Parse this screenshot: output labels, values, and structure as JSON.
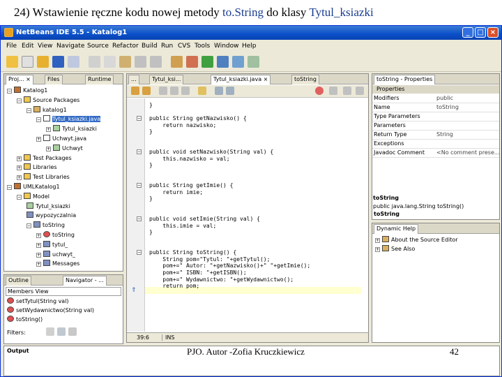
{
  "slide": {
    "title_prefix": "24) Wstawienie ręczne kodu nowej metody",
    "title_method": "to.String",
    "title_mid": "do klasy",
    "title_class": "Tytul_ksiazki",
    "footer_author": "PJO.  Autor -Zofia Kruczkiewicz",
    "page_number": "42"
  },
  "window": {
    "title": "NetBeans IDE 5.5 - Katalog1",
    "buttons": {
      "minimize": "_",
      "maximize": "□",
      "close": "×"
    }
  },
  "menu": [
    "File",
    "Edit",
    "View",
    "Navigate",
    "Source",
    "Refactor",
    "Build",
    "Run",
    "CVS",
    "Tools",
    "Window",
    "Help"
  ],
  "projects_panel": {
    "tabs": [
      "Proj... ×",
      "Files",
      "Runtime"
    ],
    "tree": [
      {
        "label": "Katalog1",
        "icon": "project-icon",
        "depth": 0,
        "exp": "−"
      },
      {
        "label": "Source Packages",
        "icon": "folder-icon",
        "depth": 1,
        "exp": "−"
      },
      {
        "label": "katalog1",
        "icon": "package-icon",
        "depth": 2,
        "exp": "−"
      },
      {
        "label": "Tytul_ksiazki.java",
        "icon": "java-file-icon",
        "depth": 3,
        "exp": "−",
        "selected": true
      },
      {
        "label": "Tytul_ksiazki",
        "icon": "class-icon",
        "depth": 4,
        "exp": "+"
      },
      {
        "label": "Uchwyt.java",
        "icon": "java-file-icon",
        "depth": 3,
        "exp": "+"
      },
      {
        "label": "Uchwyt",
        "icon": "class-icon",
        "depth": 4,
        "exp": "+"
      },
      {
        "label": "Test Packages",
        "icon": "folder-icon",
        "depth": 1,
        "exp": "+"
      },
      {
        "label": "Libraries",
        "icon": "folder-icon",
        "depth": 1,
        "exp": "+"
      },
      {
        "label": "Test Libraries",
        "icon": "folder-icon",
        "depth": 1,
        "exp": "+"
      },
      {
        "label": "UMLKatalog1",
        "icon": "project-icon",
        "depth": 0,
        "exp": "−"
      },
      {
        "label": "Model",
        "icon": "folder-icon",
        "depth": 1,
        "exp": "−"
      },
      {
        "label": "Tytul_ksiazki",
        "icon": "class-icon",
        "depth": 2,
        "exp": ""
      },
      {
        "label": "wypozyczalnia",
        "icon": "node-icon",
        "depth": 2,
        "exp": ""
      },
      {
        "label": "toString",
        "icon": "node-icon",
        "depth": 2,
        "exp": "−"
      },
      {
        "label": "toString",
        "icon": "method-icon",
        "depth": 3,
        "exp": "+"
      },
      {
        "label": "tytul_",
        "icon": "node-icon",
        "depth": 3,
        "exp": "+"
      },
      {
        "label": "uchwyt_",
        "icon": "node-icon",
        "depth": 3,
        "exp": "+"
      },
      {
        "label": "Messages",
        "icon": "node-icon",
        "depth": 3,
        "exp": "+"
      }
    ]
  },
  "navigator_panel": {
    "tabs": [
      "Outline",
      "Navigator - ..."
    ],
    "view": "Members View",
    "items": [
      "setTytul(String val)",
      "setWydawnictwo(String val)",
      "toString()"
    ],
    "filters_label": "Filters:"
  },
  "editor": {
    "tabs": [
      "...",
      "Tytul_ksi...",
      "Tytul_ksiazki.java ×",
      "toString"
    ],
    "status_position": "39:6",
    "status_mode": "INS",
    "lines": [
      {
        "text": "}",
        "fold": ""
      },
      {
        "text": "",
        "fold": ""
      },
      {
        "text": "public String getNazwisko() {",
        "fold": "−"
      },
      {
        "text": "    return nazwisko;",
        "fold": ""
      },
      {
        "text": "}",
        "fold": ""
      },
      {
        "text": "",
        "fold": ""
      },
      {
        "text": "",
        "fold": ""
      },
      {
        "text": "public void setNazwisko(String val) {",
        "fold": "−"
      },
      {
        "text": "    this.nazwisko = val;",
        "fold": ""
      },
      {
        "text": "}",
        "fold": ""
      },
      {
        "text": "",
        "fold": ""
      },
      {
        "text": "",
        "fold": ""
      },
      {
        "text": "public String getImie() {",
        "fold": "−"
      },
      {
        "text": "    return imie;",
        "fold": ""
      },
      {
        "text": "}",
        "fold": ""
      },
      {
        "text": "",
        "fold": ""
      },
      {
        "text": "",
        "fold": ""
      },
      {
        "text": "public void setImie(String val) {",
        "fold": "−"
      },
      {
        "text": "    this.imie = val;",
        "fold": ""
      },
      {
        "text": "}",
        "fold": ""
      },
      {
        "text": "",
        "fold": ""
      },
      {
        "text": "",
        "fold": ""
      },
      {
        "text": "public String toString() {",
        "fold": "−"
      },
      {
        "text": "    String pom=\"Tytul: \"+getTytul();",
        "fold": ""
      },
      {
        "text": "    pom+=\" Autor: \"+getNazwisko()+\" \"+getImie();",
        "fold": ""
      },
      {
        "text": "    pom+=\" ISBN: \"+getISBN();",
        "fold": ""
      },
      {
        "text": "    pom+=\" Wydawnictwo: \"+getWydawnictwo();",
        "fold": ""
      },
      {
        "text": "    return pom;",
        "fold": ""
      }
    ]
  },
  "properties_panel": {
    "title": "toString - Properties",
    "section": "Properties",
    "rows": [
      {
        "key": "Modifiers",
        "value": "public"
      },
      {
        "key": "Name",
        "value": "toString"
      },
      {
        "key": "Type Parameters",
        "value": ""
      },
      {
        "key": "Parameters",
        "value": ""
      },
      {
        "key": "Return Type",
        "value": "String"
      },
      {
        "key": "Exceptions",
        "value": ""
      },
      {
        "key": "Javadoc Comment",
        "value": "<No comment prese..."
      }
    ],
    "desc_title": "toString",
    "desc_text": "public java.lang.String toString()"
  },
  "help_panel": {
    "title": "Dynamic Help",
    "items": [
      "About the Source Editor",
      "See Also"
    ]
  },
  "output_panel": {
    "title": "Output"
  },
  "colors": {
    "titlebar": "#0a4fc9",
    "selection": "#316ac5",
    "keyword": "#000080",
    "string": "#b00000",
    "window_bg": "#ece9d8"
  }
}
